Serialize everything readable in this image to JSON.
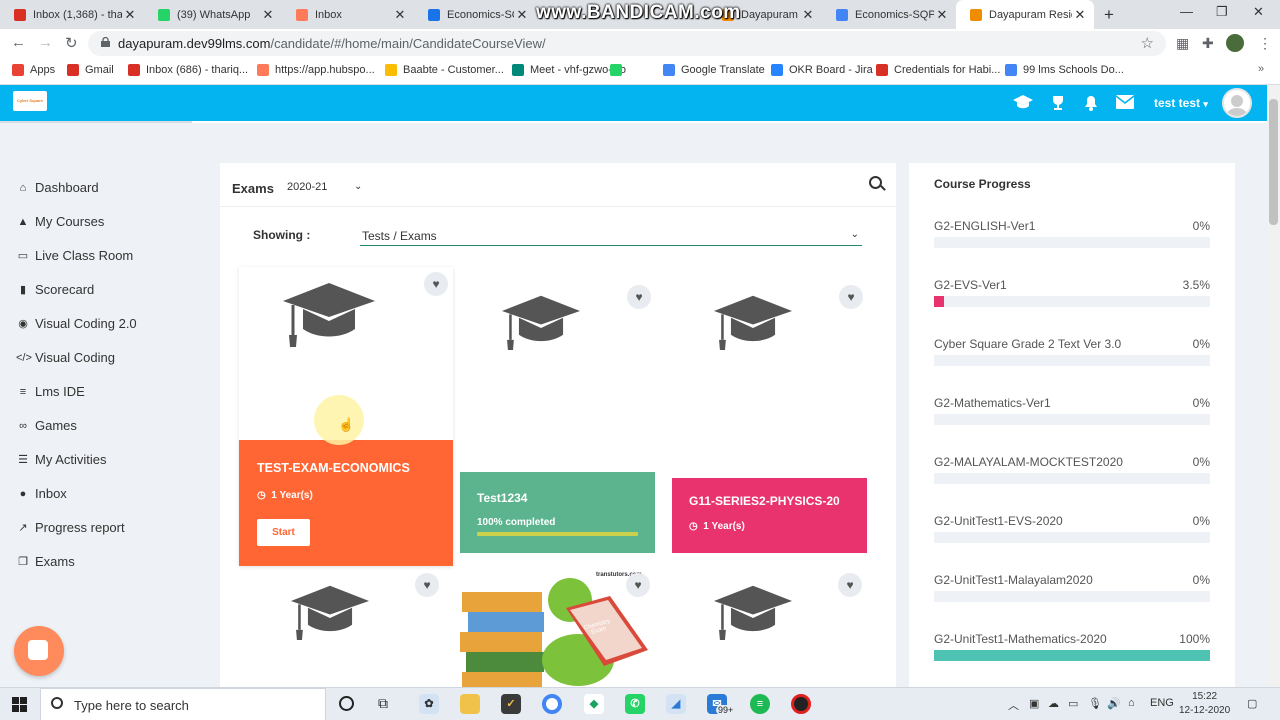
{
  "browser": {
    "tabs": [
      {
        "label": "Inbox (1,368) - tha",
        "icon_color": "#d93025",
        "icon": "gmail-icon",
        "active": false
      },
      {
        "label": "(39) WhatsApp",
        "icon_color": "#25d366",
        "icon": "whatsapp-icon",
        "active": false
      },
      {
        "label": "Inbox",
        "icon_color": "#ff7a59",
        "icon": "hubspot-icon",
        "active": false
      },
      {
        "label": "Economics-SQP.pd",
        "icon_color": "#1a73e8",
        "icon": "drive-icon",
        "active": false
      },
      {
        "label": "Dayapuram Reside",
        "icon_color": "#f08c00",
        "icon": "site-icon",
        "active": false
      },
      {
        "label": "Economics-SQP - G",
        "icon_color": "#4285f4",
        "icon": "docs-icon",
        "active": false
      },
      {
        "label": "Dayapuram Reside",
        "icon_color": "#f08c00",
        "icon": "site-icon",
        "active": true
      }
    ],
    "watermark": "www.BANDICAM.com",
    "url_host": "dayapuram.dev99lms.com",
    "url_path": "/candidate/#/home/main/CandidateCourseView/",
    "bookmarks": [
      {
        "label": "Apps",
        "color": "#ea4335"
      },
      {
        "label": "Gmail",
        "color": "#d93025"
      },
      {
        "label": "Inbox (686) - thariq...",
        "color": "#d93025"
      },
      {
        "label": "https://app.hubspo...",
        "color": "#ff7a59"
      },
      {
        "label": "Baabte - Customer...",
        "color": "#fbbc04"
      },
      {
        "label": "Meet - vhf-gzwo-xjo",
        "color": "#00897b"
      },
      {
        "label": "",
        "color": "#25d366"
      },
      {
        "label": "Google Translate",
        "color": "#4285f4"
      },
      {
        "label": "OKR Board - Jira",
        "color": "#2684ff"
      },
      {
        "label": "Credentials for Habi...",
        "color": "#d93025"
      },
      {
        "label": "99 lms Schools Do...",
        "color": "#4285f4"
      }
    ]
  },
  "app": {
    "username": "test test",
    "accent": "#03b4f0",
    "logo_text": "Cyber Square"
  },
  "sidebar": {
    "items": [
      {
        "label": "Dashboard",
        "icon": "home-icon",
        "glyph": "⌂"
      },
      {
        "label": "My Courses",
        "icon": "graduation-cap-icon",
        "glyph": "▲"
      },
      {
        "label": "Live Class Room",
        "icon": "monitor-icon",
        "glyph": "▭"
      },
      {
        "label": "Scorecard",
        "icon": "book-icon",
        "glyph": "▮"
      },
      {
        "label": "Visual Coding 2.0",
        "icon": "github-icon",
        "glyph": "◉"
      },
      {
        "label": "Visual Coding",
        "icon": "code-icon",
        "glyph": "</>"
      },
      {
        "label": "Lms IDE",
        "icon": "list-icon",
        "glyph": "≡"
      },
      {
        "label": "Games",
        "icon": "gamepad-icon",
        "glyph": "∞"
      },
      {
        "label": "My Activities",
        "icon": "tasks-icon",
        "glyph": "☰"
      },
      {
        "label": "Inbox",
        "icon": "comment-icon",
        "glyph": "●"
      },
      {
        "label": "Progress report",
        "icon": "line-chart-icon",
        "glyph": "↗"
      },
      {
        "label": "Exams",
        "icon": "copy-icon",
        "glyph": "❐"
      }
    ]
  },
  "exams": {
    "title": "Exams",
    "year": "2020-21",
    "showing_label": "Showing :",
    "filter": "Tests / Exams",
    "cards": [
      {
        "name": "TEST-EXAM-ECONOMICS",
        "meta": "1 Year(s)",
        "button": "Start",
        "color": "#ff6633"
      },
      {
        "name": "Test1234",
        "meta": "100% completed",
        "progress": 1.0,
        "color": "#5cb48e"
      },
      {
        "name": "G11-SERIES2-PHYSICS-20",
        "meta": "1 Year(s)",
        "color": "#e8336f"
      }
    ],
    "book_brand": "transtutors.com",
    "book_label": "Chemistry Exam"
  },
  "course_progress": {
    "title": "Course Progress",
    "items": [
      {
        "name": "G2-ENGLISH-Ver1",
        "value": "0%",
        "fraction": 0,
        "color": "#e8336f"
      },
      {
        "name": "G2-EVS-Ver1",
        "value": "3.5%",
        "fraction": 0.035,
        "color": "#e8336f"
      },
      {
        "name": "Cyber Square Grade 2 Text Ver 3.0",
        "value": "0%",
        "fraction": 0,
        "color": "#e8336f"
      },
      {
        "name": "G2-Mathematics-Ver1",
        "value": "0%",
        "fraction": 0,
        "color": "#e8336f"
      },
      {
        "name": "G2-MALAYALAM-MOCKTEST2020",
        "value": "0%",
        "fraction": 0,
        "color": "#e8336f"
      },
      {
        "name": "G2-UnitTest1-EVS-2020",
        "value": "0%",
        "fraction": 0,
        "color": "#e8336f"
      },
      {
        "name": "G2-UnitTest1-Malayalam2020",
        "value": "0%",
        "fraction": 0,
        "color": "#e8336f"
      },
      {
        "name": "G2-UnitTest1-Mathematics-2020",
        "value": "100%",
        "fraction": 1,
        "color": "#4ec3b4"
      }
    ]
  },
  "taskbar": {
    "search_placeholder": "Type here to search",
    "lang": "ENG",
    "time": "15:22",
    "date": "12-12-2020",
    "badge": "99+"
  }
}
